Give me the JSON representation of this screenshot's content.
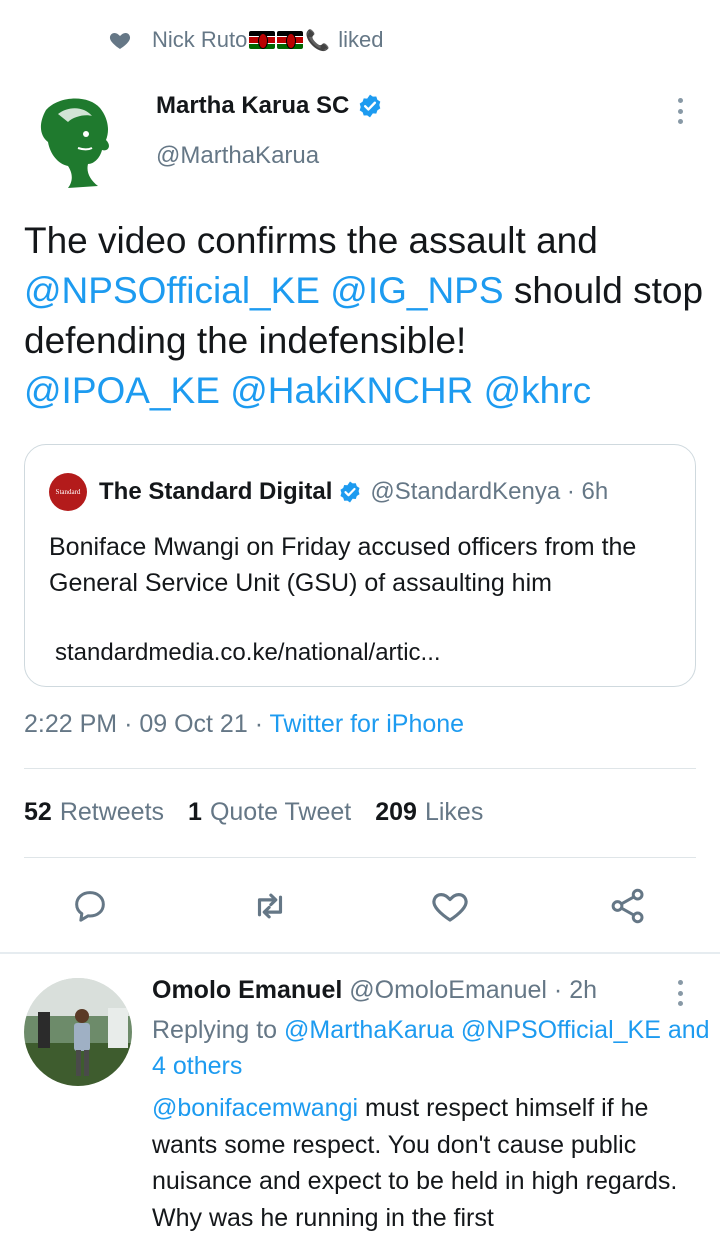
{
  "social_context": {
    "icon": "heart-icon",
    "user": "Nick Ruto",
    "action": "liked"
  },
  "tweet": {
    "author_name": "Martha Karua SC",
    "author_handle": "@MarthaKarua",
    "text_1": "The video confirms the assault and",
    "mention_1": "@NPSOfficial_KE",
    "mention_2": "@IG_NPS",
    "text_2": "should stop defending the indefensible!",
    "mention_3": "@IPOA_KE",
    "mention_4": "@HakiKNCHR",
    "mention_5": "@khrc",
    "time": "2:22 PM",
    "date": "09 Oct 21",
    "source": "Twitter for iPhone"
  },
  "quote": {
    "logo_text": "Standard",
    "name": "The Standard Digital",
    "handle": "@StandardKenya",
    "age": "6h",
    "text": "Boniface  Mwangi on Friday accused officers from the General Service Unit (GSU) of assaulting him",
    "link": "standardmedia.co.ke/national/artic..."
  },
  "stats": {
    "retweets_count": "52",
    "retweets_label": "Retweets",
    "quotes_count": "1",
    "quotes_label": "Quote Tweet",
    "likes_count": "209",
    "likes_label": "Likes"
  },
  "actions": [
    "reply-icon",
    "retweet-icon",
    "like-icon",
    "share-icon"
  ],
  "reply": {
    "author_name": "Omolo Emanuel",
    "author_handle": "@OmoloEmanuel",
    "age": "2h",
    "replying_prefix": "Replying to",
    "replying_1": "@MarthaKarua",
    "replying_2": "@NPSOfficial_KE",
    "replying_3": "and 4 others",
    "mention": "@bonifacemwangi",
    "text": "must respect himself if he wants some respect. You don't cause public nuisance and expect to be held in high regards. Why was he running in the first"
  },
  "colors": {
    "accent": "#1d9bf0",
    "muted": "#657786",
    "text": "#14171a"
  }
}
